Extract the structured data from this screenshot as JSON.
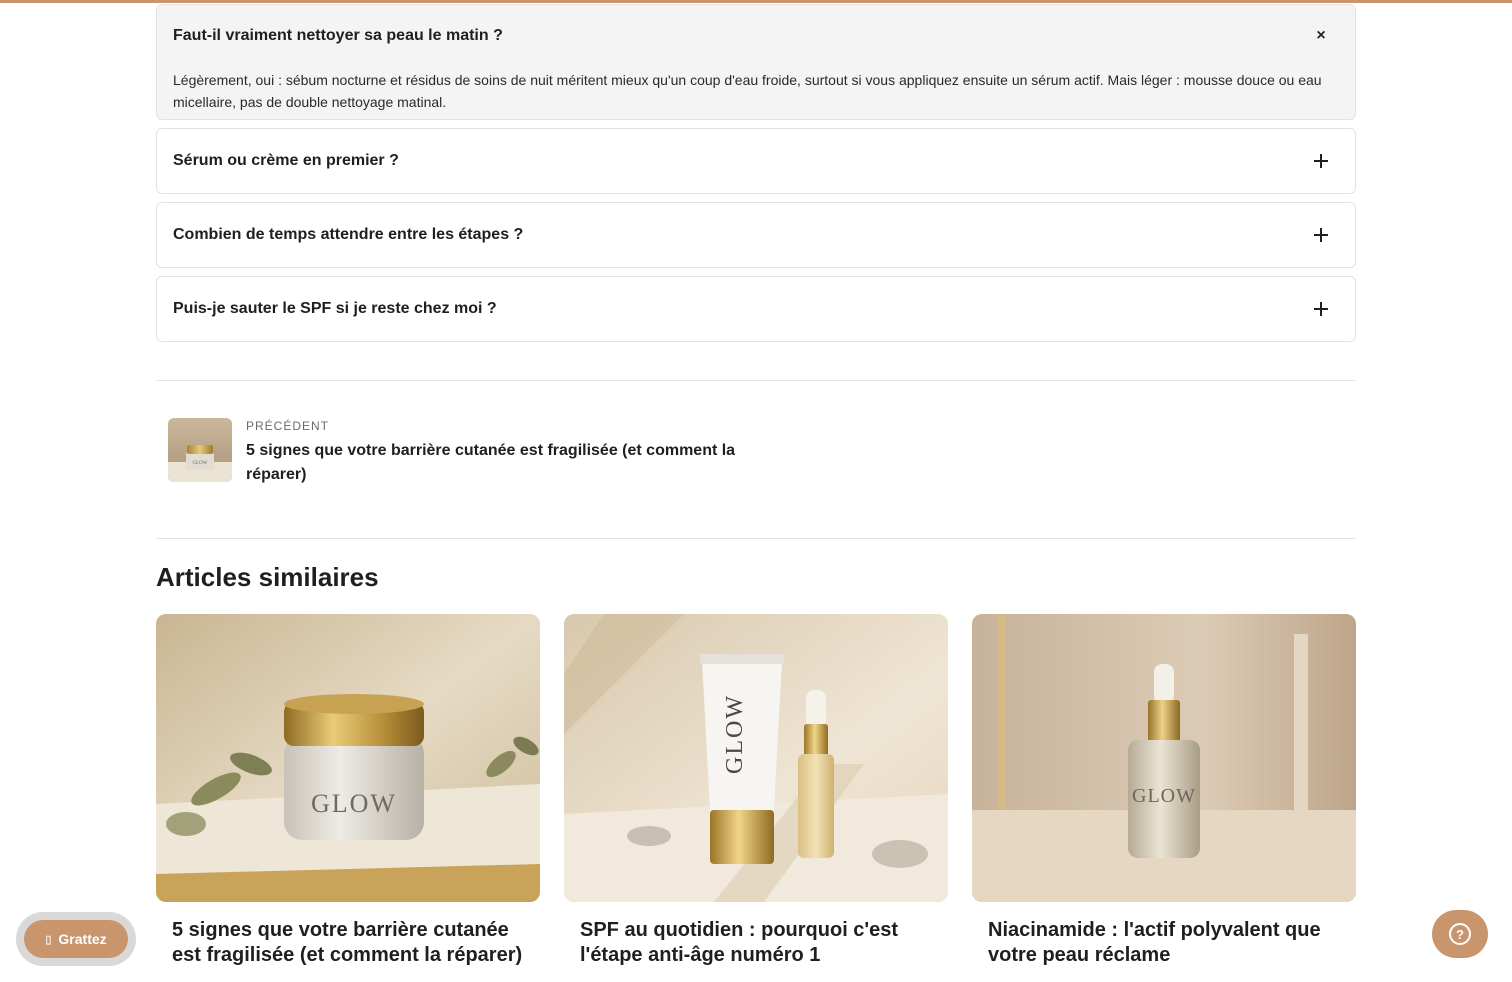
{
  "faq": [
    {
      "question": "Faut-il vraiment nettoyer sa peau le matin ?",
      "answer": "Légèrement, oui : sébum nocturne et résidus de soins de nuit méritent mieux qu'un coup d'eau froide, surtout si vous appliquez ensuite un sérum actif. Mais léger : mousse douce ou eau micellaire, pas de double nettoyage matinal.",
      "open": true,
      "toggle_glyph": "×"
    },
    {
      "question": "Sérum ou crème en premier ?",
      "open": false
    },
    {
      "question": "Combien de temps attendre entre les étapes ?",
      "open": false
    },
    {
      "question": "Puis-je sauter le SPF si je reste chez moi ?",
      "open": false
    }
  ],
  "prev_nav": {
    "kicker": "PRÉCÉDENT",
    "title": "5 signes que votre barrière cutanée est fragilisée (et comment la réparer)",
    "thumb_text": "GLOW"
  },
  "related": {
    "heading": "Articles similaires",
    "cards": [
      {
        "title": "5 signes que votre barrière cutanée est fragilisée (et comment la réparer)",
        "brand": "GLOW"
      },
      {
        "title": "SPF au quotidien : pourquoi c'est l'étape anti-âge numéro 1",
        "brand": "GLOW"
      },
      {
        "title": "Niacinamide : l'actif polyvalent que votre peau réclame",
        "brand": "GLOW"
      }
    ]
  },
  "floating": {
    "scratch_label": "Grattez",
    "scratch_icon": "gift-icon",
    "help_glyph": "?"
  },
  "colors": {
    "accent": "#c9956d",
    "border": "#e3e3e3",
    "open_bg": "#f4f4f4"
  }
}
